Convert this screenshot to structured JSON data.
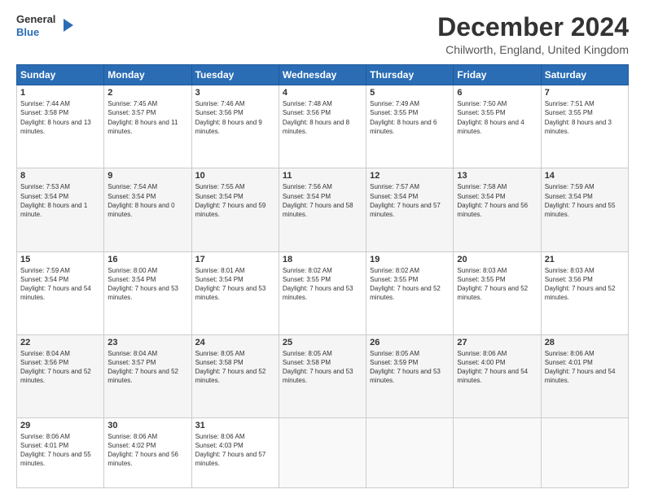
{
  "header": {
    "logo_line1": "General",
    "logo_line2": "Blue",
    "title": "December 2024",
    "subtitle": "Chilworth, England, United Kingdom"
  },
  "days_of_week": [
    "Sunday",
    "Monday",
    "Tuesday",
    "Wednesday",
    "Thursday",
    "Friday",
    "Saturday"
  ],
  "weeks": [
    [
      {
        "day": "1",
        "sunrise": "7:44 AM",
        "sunset": "3:58 PM",
        "daylight": "8 hours and 13 minutes."
      },
      {
        "day": "2",
        "sunrise": "7:45 AM",
        "sunset": "3:57 PM",
        "daylight": "8 hours and 11 minutes."
      },
      {
        "day": "3",
        "sunrise": "7:46 AM",
        "sunset": "3:56 PM",
        "daylight": "8 hours and 9 minutes."
      },
      {
        "day": "4",
        "sunrise": "7:48 AM",
        "sunset": "3:56 PM",
        "daylight": "8 hours and 8 minutes."
      },
      {
        "day": "5",
        "sunrise": "7:49 AM",
        "sunset": "3:55 PM",
        "daylight": "8 hours and 6 minutes."
      },
      {
        "day": "6",
        "sunrise": "7:50 AM",
        "sunset": "3:55 PM",
        "daylight": "8 hours and 4 minutes."
      },
      {
        "day": "7",
        "sunrise": "7:51 AM",
        "sunset": "3:55 PM",
        "daylight": "8 hours and 3 minutes."
      }
    ],
    [
      {
        "day": "8",
        "sunrise": "7:53 AM",
        "sunset": "3:54 PM",
        "daylight": "8 hours and 1 minute."
      },
      {
        "day": "9",
        "sunrise": "7:54 AM",
        "sunset": "3:54 PM",
        "daylight": "8 hours and 0 minutes."
      },
      {
        "day": "10",
        "sunrise": "7:55 AM",
        "sunset": "3:54 PM",
        "daylight": "7 hours and 59 minutes."
      },
      {
        "day": "11",
        "sunrise": "7:56 AM",
        "sunset": "3:54 PM",
        "daylight": "7 hours and 58 minutes."
      },
      {
        "day": "12",
        "sunrise": "7:57 AM",
        "sunset": "3:54 PM",
        "daylight": "7 hours and 57 minutes."
      },
      {
        "day": "13",
        "sunrise": "7:58 AM",
        "sunset": "3:54 PM",
        "daylight": "7 hours and 56 minutes."
      },
      {
        "day": "14",
        "sunrise": "7:59 AM",
        "sunset": "3:54 PM",
        "daylight": "7 hours and 55 minutes."
      }
    ],
    [
      {
        "day": "15",
        "sunrise": "7:59 AM",
        "sunset": "3:54 PM",
        "daylight": "7 hours and 54 minutes."
      },
      {
        "day": "16",
        "sunrise": "8:00 AM",
        "sunset": "3:54 PM",
        "daylight": "7 hours and 53 minutes."
      },
      {
        "day": "17",
        "sunrise": "8:01 AM",
        "sunset": "3:54 PM",
        "daylight": "7 hours and 53 minutes."
      },
      {
        "day": "18",
        "sunrise": "8:02 AM",
        "sunset": "3:55 PM",
        "daylight": "7 hours and 53 minutes."
      },
      {
        "day": "19",
        "sunrise": "8:02 AM",
        "sunset": "3:55 PM",
        "daylight": "7 hours and 52 minutes."
      },
      {
        "day": "20",
        "sunrise": "8:03 AM",
        "sunset": "3:55 PM",
        "daylight": "7 hours and 52 minutes."
      },
      {
        "day": "21",
        "sunrise": "8:03 AM",
        "sunset": "3:56 PM",
        "daylight": "7 hours and 52 minutes."
      }
    ],
    [
      {
        "day": "22",
        "sunrise": "8:04 AM",
        "sunset": "3:56 PM",
        "daylight": "7 hours and 52 minutes."
      },
      {
        "day": "23",
        "sunrise": "8:04 AM",
        "sunset": "3:57 PM",
        "daylight": "7 hours and 52 minutes."
      },
      {
        "day": "24",
        "sunrise": "8:05 AM",
        "sunset": "3:58 PM",
        "daylight": "7 hours and 52 minutes."
      },
      {
        "day": "25",
        "sunrise": "8:05 AM",
        "sunset": "3:58 PM",
        "daylight": "7 hours and 53 minutes."
      },
      {
        "day": "26",
        "sunrise": "8:05 AM",
        "sunset": "3:59 PM",
        "daylight": "7 hours and 53 minutes."
      },
      {
        "day": "27",
        "sunrise": "8:06 AM",
        "sunset": "4:00 PM",
        "daylight": "7 hours and 54 minutes."
      },
      {
        "day": "28",
        "sunrise": "8:06 AM",
        "sunset": "4:01 PM",
        "daylight": "7 hours and 54 minutes."
      }
    ],
    [
      {
        "day": "29",
        "sunrise": "8:06 AM",
        "sunset": "4:01 PM",
        "daylight": "7 hours and 55 minutes."
      },
      {
        "day": "30",
        "sunrise": "8:06 AM",
        "sunset": "4:02 PM",
        "daylight": "7 hours and 56 minutes."
      },
      {
        "day": "31",
        "sunrise": "8:06 AM",
        "sunset": "4:03 PM",
        "daylight": "7 hours and 57 minutes."
      },
      null,
      null,
      null,
      null
    ]
  ]
}
